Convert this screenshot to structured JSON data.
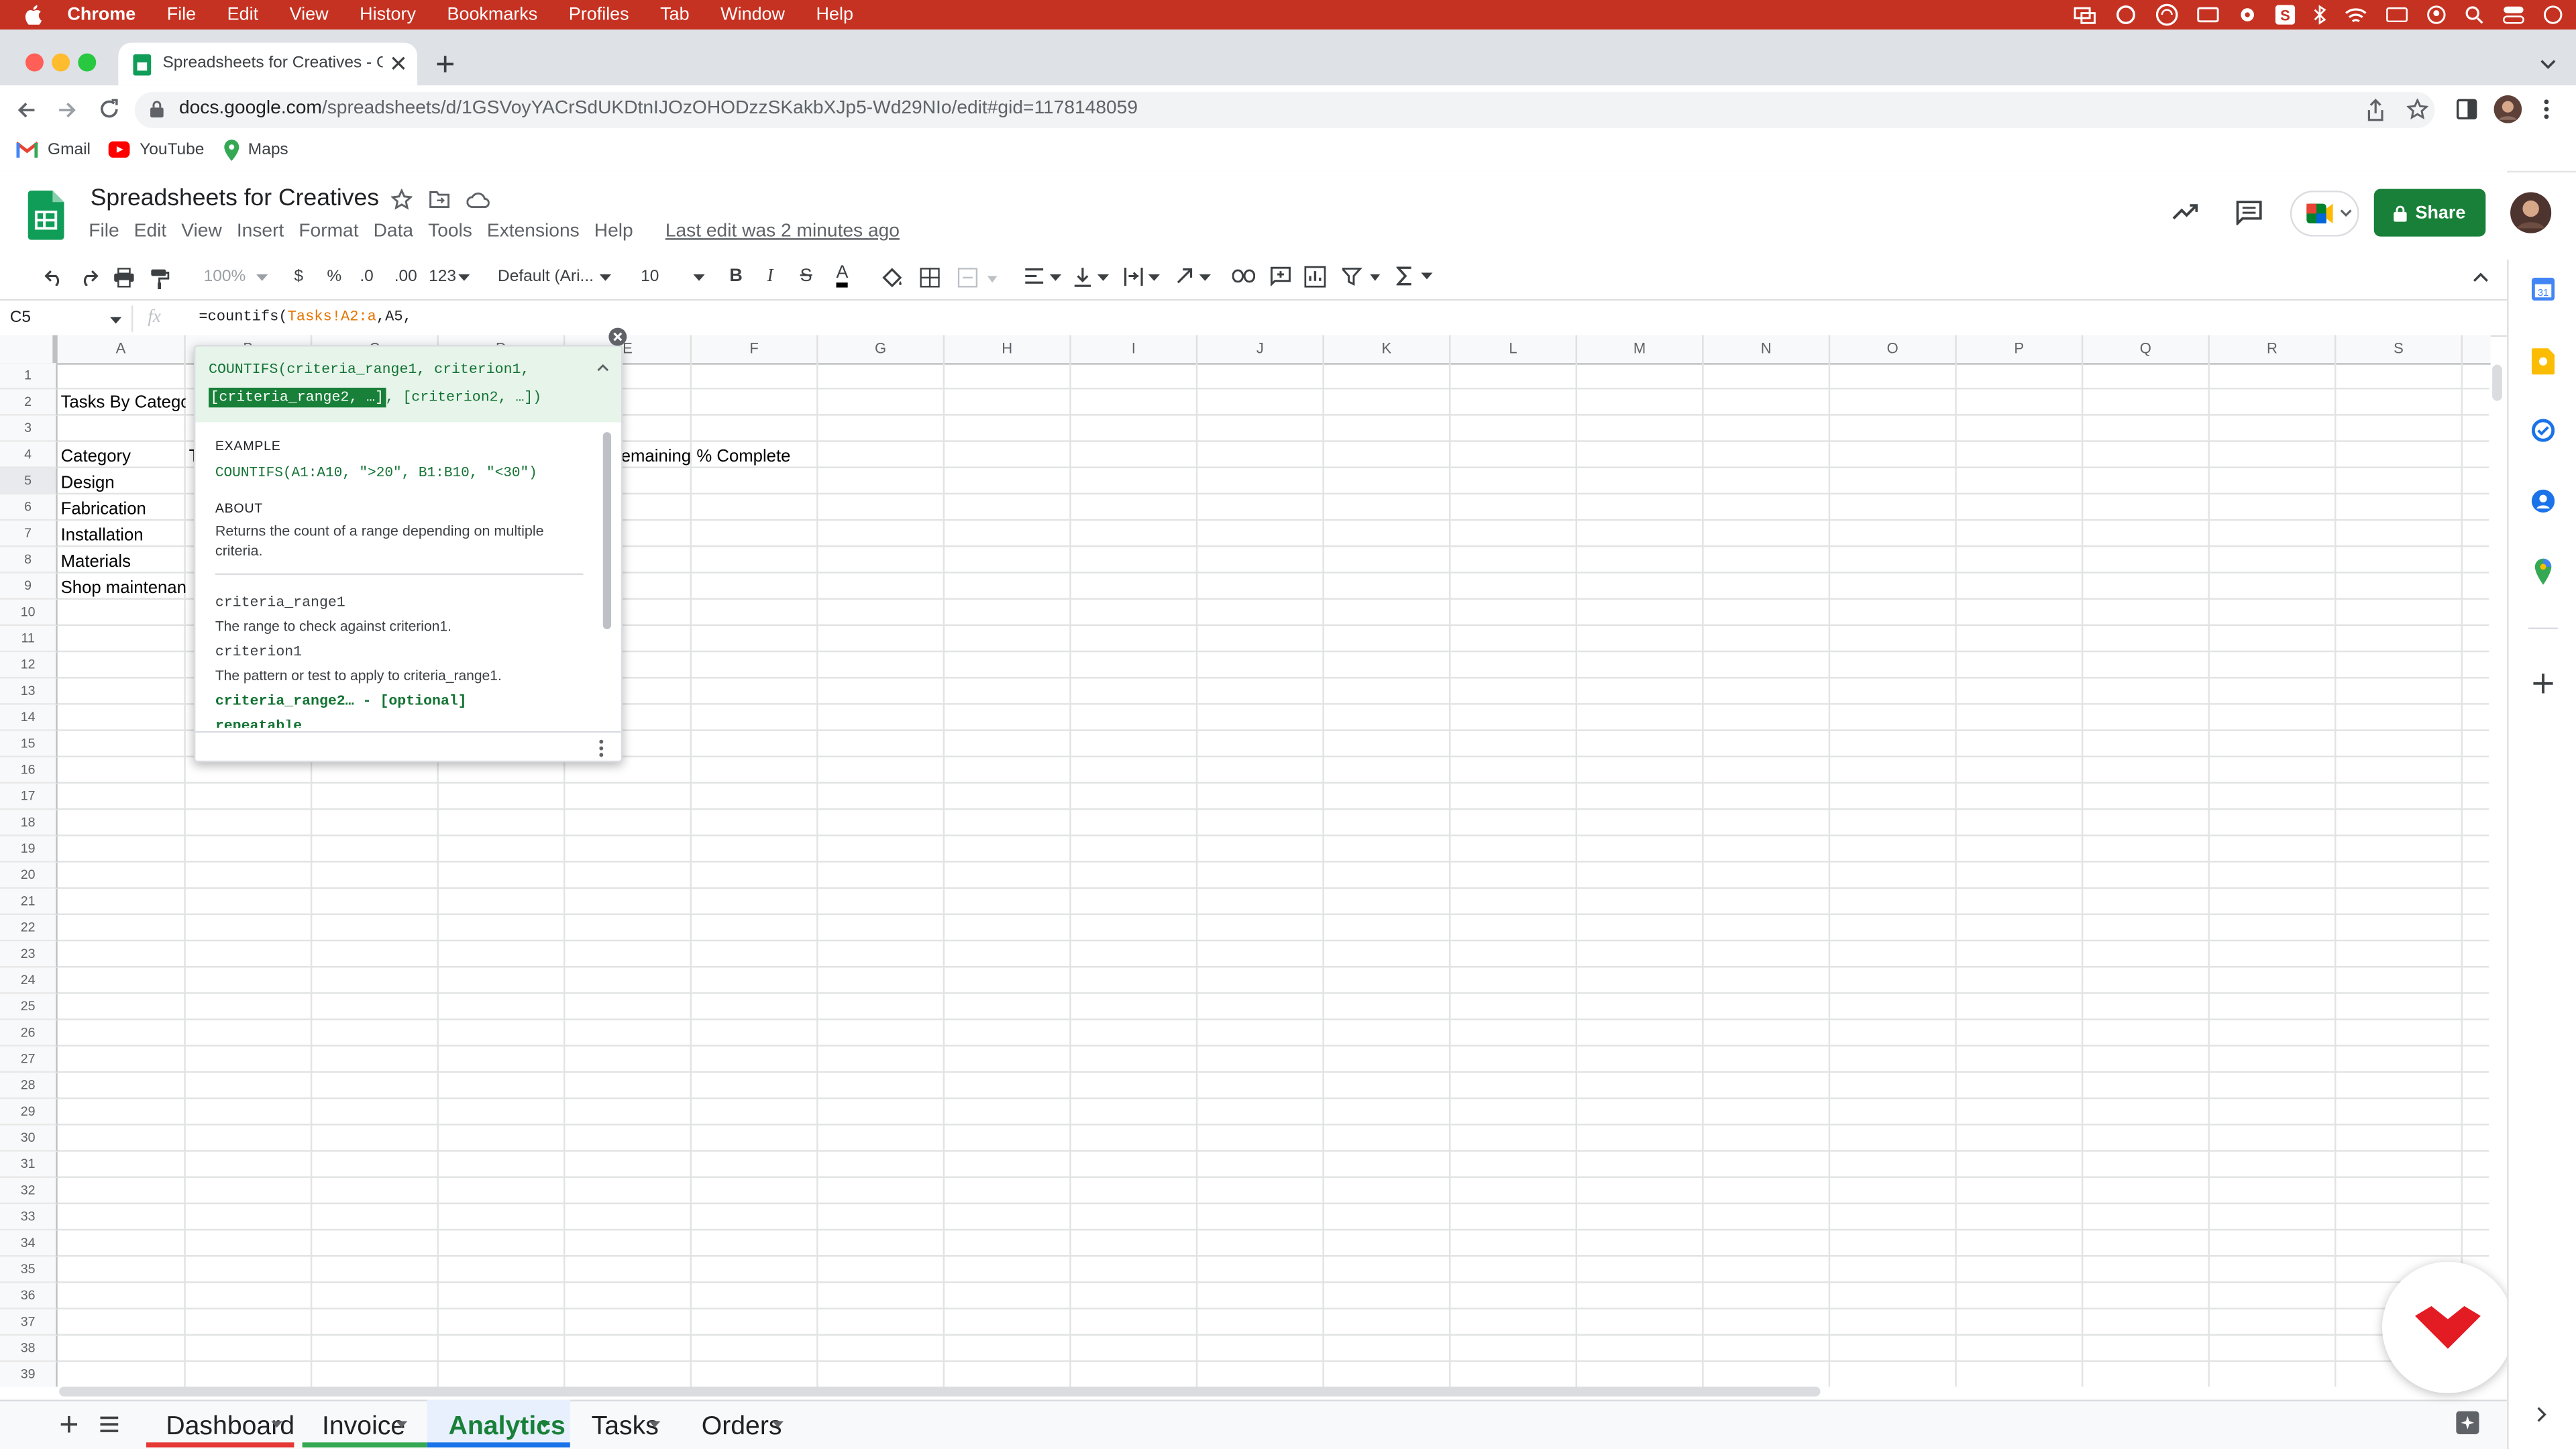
{
  "menubar": {
    "app": "Chrome",
    "items": [
      "File",
      "Edit",
      "View",
      "History",
      "Bookmarks",
      "Profiles",
      "Tab",
      "Window",
      "Help"
    ]
  },
  "browser": {
    "tab_title": "Spreadsheets for Creatives - G",
    "url_host": "docs.google.com",
    "url_path": "/spreadsheets/d/1GSVoyYACrSdUKDtnIJOzOHODzzSKakbXJp5-Wd29NIo/edit#gid=1178148059",
    "bookmarks": [
      "Gmail",
      "YouTube",
      "Maps"
    ]
  },
  "doc": {
    "title": "Spreadsheets for Creatives",
    "menu": [
      "File",
      "Edit",
      "View",
      "Insert",
      "Format",
      "Data",
      "Tools",
      "Extensions",
      "Help"
    ],
    "last_edit": "Last edit was 2 minutes ago",
    "share_label": "Share"
  },
  "format_toolbar": {
    "zoom": "100%",
    "currency": "$",
    "percent": "%",
    "dec_decrease": ".0",
    "dec_increase": ".00",
    "more_formats": "123",
    "font": "Default (Ari...",
    "font_size": "10",
    "bold": "B",
    "italic": "I",
    "strike": "S",
    "text_color": "A"
  },
  "formula_bar": {
    "cell_ref": "C5",
    "fx": "fx",
    "formula_prefix": "=countifs(",
    "formula_range": "Tasks!A2:a",
    "formula_suffix": ",A5,"
  },
  "grid": {
    "columns": [
      "A",
      "B",
      "C",
      "D",
      "E",
      "F",
      "G",
      "H",
      "I",
      "J",
      "K",
      "L",
      "M",
      "N",
      "O",
      "P",
      "Q",
      "R",
      "S"
    ],
    "rows": [
      "1",
      "2",
      "3",
      "4",
      "5",
      "6",
      "7",
      "8",
      "9",
      "10",
      "11",
      "12",
      "13",
      "14",
      "15",
      "16",
      "17",
      "18",
      "19",
      "20",
      "21",
      "22",
      "23",
      "24",
      "25",
      "26",
      "27",
      "28",
      "29",
      "30",
      "31",
      "32",
      "33",
      "34",
      "35",
      "36",
      "37",
      "38",
      "39"
    ],
    "cells": {
      "a2": "Tasks By Categor",
      "a4": "Category",
      "b4": "T",
      "e4": "emaining",
      "f4": "% Complete",
      "a5": "Design",
      "a6": "Fabrication",
      "a7": "Installation",
      "a8": "Materials",
      "a9": "Shop maintenan"
    }
  },
  "fn_help": {
    "sig_line1": "COUNTIFS(criteria_range1, criterion1,",
    "sig_highlight": "[criteria_range2, …]",
    "sig_rest": ", [criterion2, …])",
    "example_label": "EXAMPLE",
    "example": "COUNTIFS(A1:A10, \">20\", B1:B10, \"<30\")",
    "about_label": "ABOUT",
    "about": "Returns the count of a range depending on multiple criteria.",
    "param1_name": "criteria_range1",
    "param1_desc": "The range to check against criterion1.",
    "param2_name": "criterion1",
    "param2_desc": "The pattern or test to apply to criteria_range1.",
    "param3_name": "criteria_range2… - [optional]",
    "param3_more": "repeatable"
  },
  "sheets": [
    "Dashboard",
    "Invoice",
    "Analytics",
    "Tasks",
    "Orders"
  ],
  "colors": {
    "menubar": "#c63222",
    "share": "#188038",
    "sheets_green": "#0f9d58",
    "active_tab": "#1a73e8"
  }
}
